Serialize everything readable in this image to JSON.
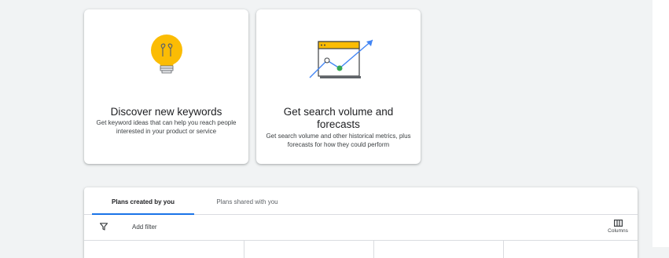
{
  "cards": [
    {
      "title": "Discover new keywords",
      "description": "Get keyword ideas that can help you reach people interested in your product or service",
      "icon": "lightbulb-icon"
    },
    {
      "title": "Get search volume and forecasts",
      "description": "Get search volume and other historical metrics, plus forecasts for how they could perform",
      "icon": "forecast-chart-icon"
    }
  ],
  "plans": {
    "tabs": [
      {
        "label": "Plans created by you",
        "selected": true
      },
      {
        "label": "Plans shared with you",
        "selected": false
      }
    ],
    "toolbar": {
      "filter_icon": "filter-icon",
      "add_filter_label": "Add filter",
      "columns_icon": "columns-icon",
      "columns_label": "Columns"
    }
  },
  "colors": {
    "background": "#f1f3f4",
    "accent": "#1a73e8",
    "bulb": "#fbbc04",
    "green": "#34a853"
  }
}
